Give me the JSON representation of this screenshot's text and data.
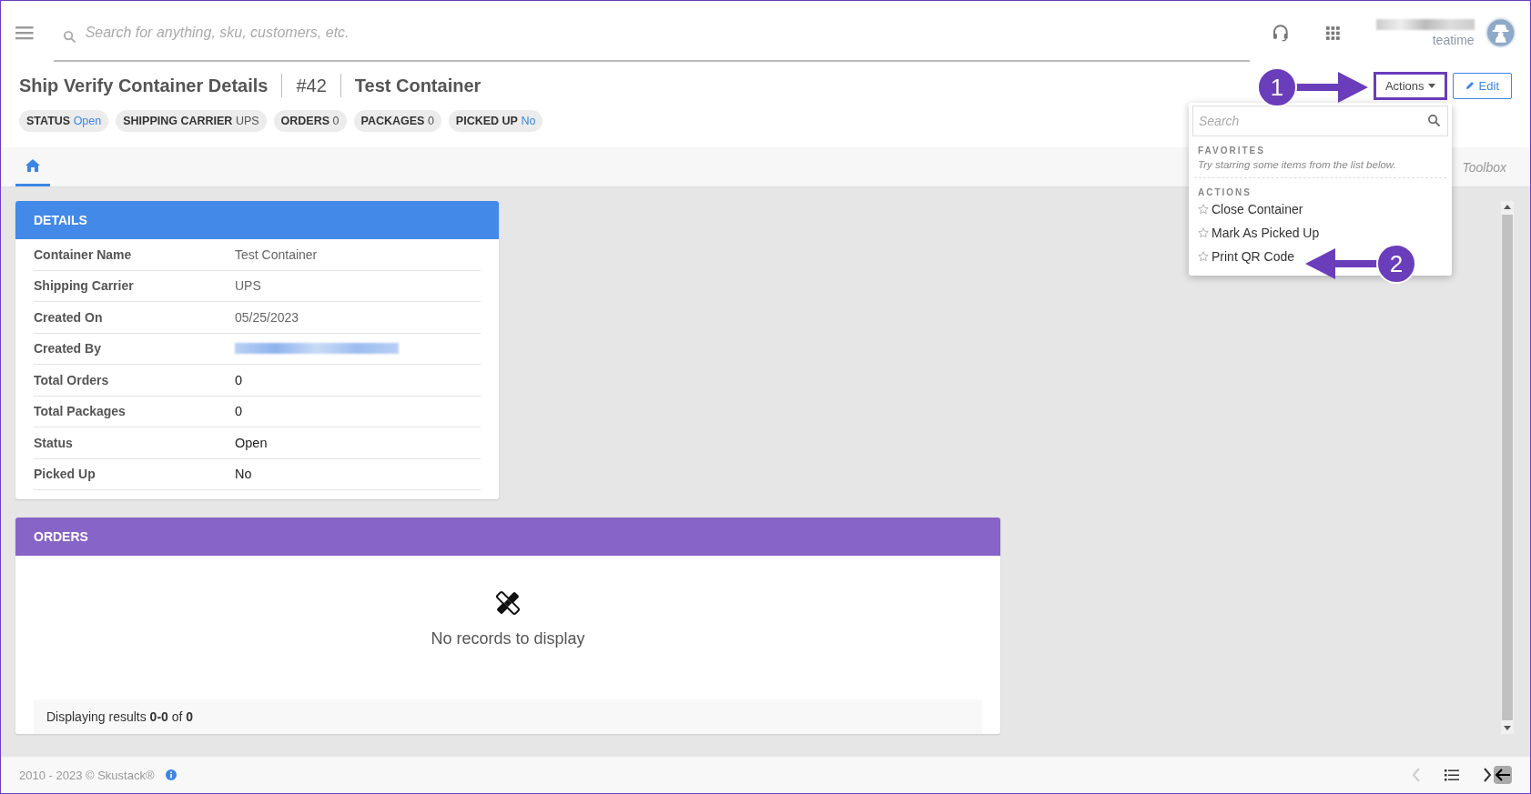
{
  "top_bar": {
    "search": {
      "placeholder": "Search for anything, sku, customers, etc."
    },
    "user_subtitle": "teatime"
  },
  "header": {
    "title": "Ship Verify Container Details",
    "number": "#42",
    "name": "Test Container",
    "chips": [
      {
        "label": "STATUS",
        "value": "Open",
        "kind": "link"
      },
      {
        "label": "SHIPPING CARRIER",
        "value": "UPS",
        "kind": "plain"
      },
      {
        "label": "ORDERS",
        "value": "0",
        "kind": "plain"
      },
      {
        "label": "PACKAGES",
        "value": "0",
        "kind": "plain"
      },
      {
        "label": "PICKED UP",
        "value": "No",
        "kind": "link"
      }
    ],
    "actions_button": {
      "label": "Actions",
      "highlighted": true
    },
    "edit_button": {
      "label": "Edit"
    }
  },
  "tabs": [
    {
      "kind": "home",
      "selected": true
    }
  ],
  "toolbox": "Toolbox",
  "dropdown": {
    "search": {
      "placeholder": "Search"
    },
    "favorites_heading": "FAVORITES",
    "favorites_hint": "Try starring some items from the list below.",
    "actions_heading": "ACTIONS",
    "items": [
      {
        "label": "Close Container",
        "starred": false
      },
      {
        "label": "Mark As Picked Up",
        "starred": false
      },
      {
        "label": "Print QR Code",
        "starred": false
      }
    ]
  },
  "details": {
    "title": "DETAILS",
    "rows": [
      {
        "label": "Container Name",
        "value": "Test Container",
        "kind": "muted"
      },
      {
        "label": "Shipping Carrier",
        "value": "UPS",
        "kind": "muted"
      },
      {
        "label": "Created On",
        "value": "05/25/2023",
        "kind": "muted"
      },
      {
        "label": "Created By",
        "kind": "redacted"
      },
      {
        "label": "Total Orders",
        "value": "0",
        "kind": "plain"
      },
      {
        "label": "Total Packages",
        "value": "0",
        "kind": "plain"
      },
      {
        "label": "Status",
        "value": "Open",
        "kind": "plain"
      },
      {
        "label": "Picked Up",
        "value": "No",
        "kind": "plain"
      }
    ]
  },
  "orders": {
    "title": "ORDERS",
    "empty_text": "No records to display",
    "pager": "Displaying results **0-0** of **0**"
  },
  "footer": {
    "copyright": "2010 - 2023 © Skustack®"
  },
  "annotations": [
    {
      "number": "1",
      "kind": "rightward"
    },
    {
      "number": "2",
      "kind": "leftward"
    }
  ]
}
